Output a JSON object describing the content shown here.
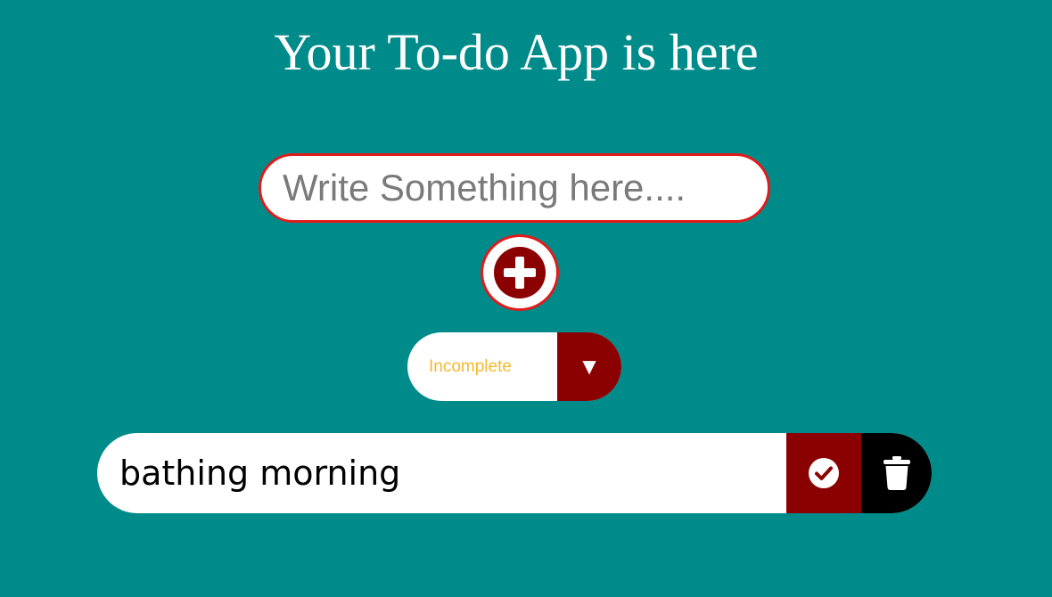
{
  "app": {
    "title": "Your To-do App is here"
  },
  "input": {
    "placeholder": "Write Something here....",
    "value": ""
  },
  "add_button": {
    "icon": "plus-circle-icon"
  },
  "filter": {
    "selected": "Incomplete",
    "arrow": "▼"
  },
  "todos": [
    {
      "text": "bathing morning",
      "complete_icon": "check-circle-icon",
      "delete_icon": "trash-icon"
    }
  ],
  "colors": {
    "background": "#008b8b",
    "accent": "#8b0000",
    "border": "#e01b1b",
    "filter_text": "#f5b82e"
  }
}
